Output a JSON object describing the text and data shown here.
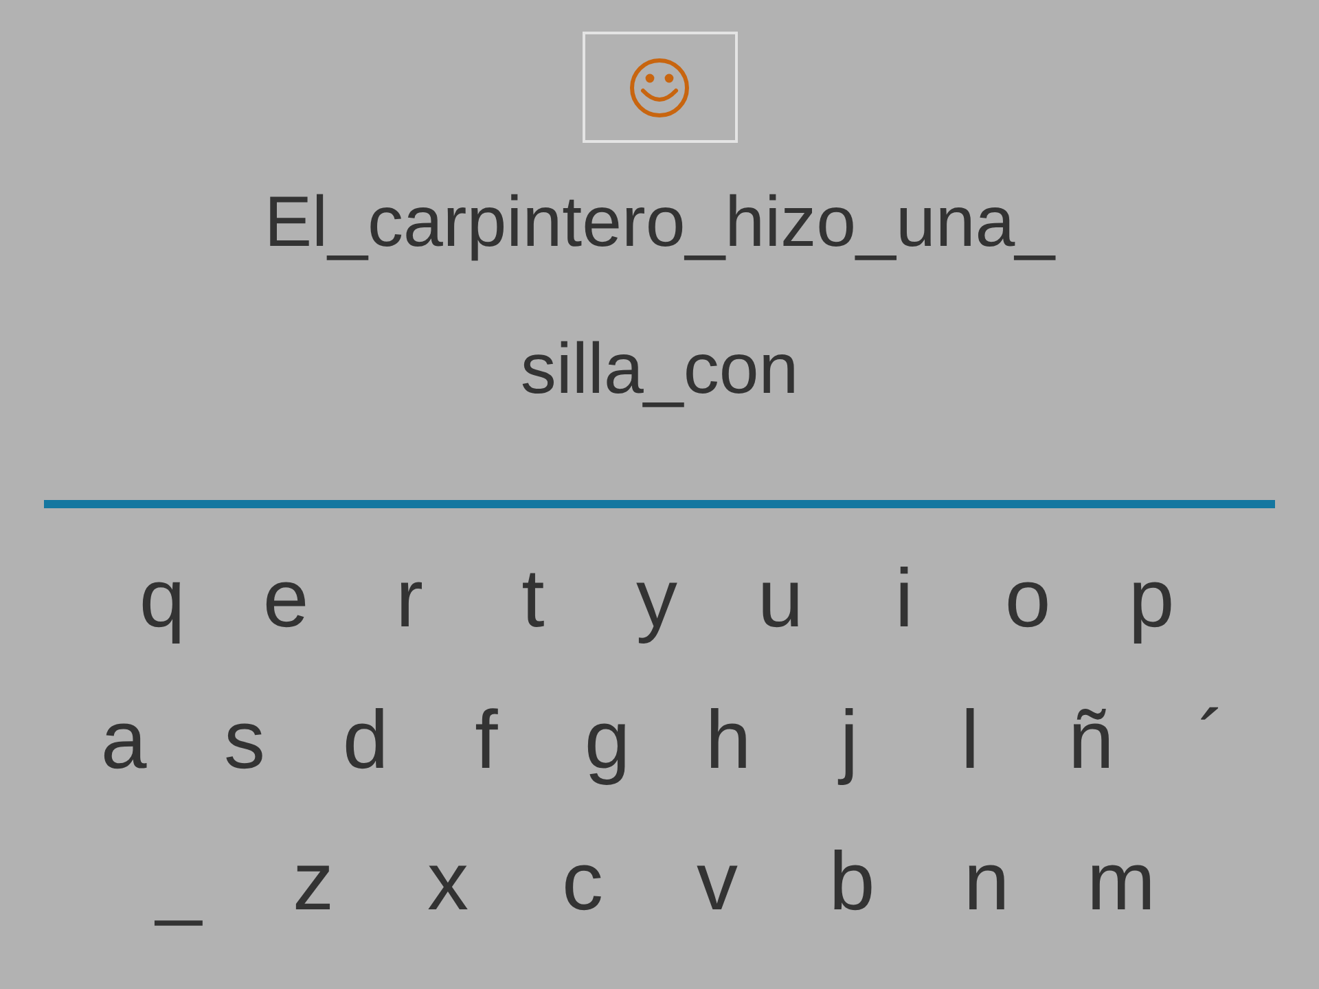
{
  "sentence_lines": [
    "El_carpintero_hizo_una_",
    "silla_con"
  ],
  "keyboard_rows": [
    [
      "q",
      "e",
      "r",
      "t",
      "y",
      "u",
      "i",
      "o",
      "p"
    ],
    [
      "a",
      "s",
      "d",
      "f",
      "g",
      "h",
      "j",
      "l",
      "ñ",
      "´"
    ],
    [
      "_",
      "z",
      "x",
      "c",
      "v",
      "b",
      "n",
      "m"
    ]
  ]
}
